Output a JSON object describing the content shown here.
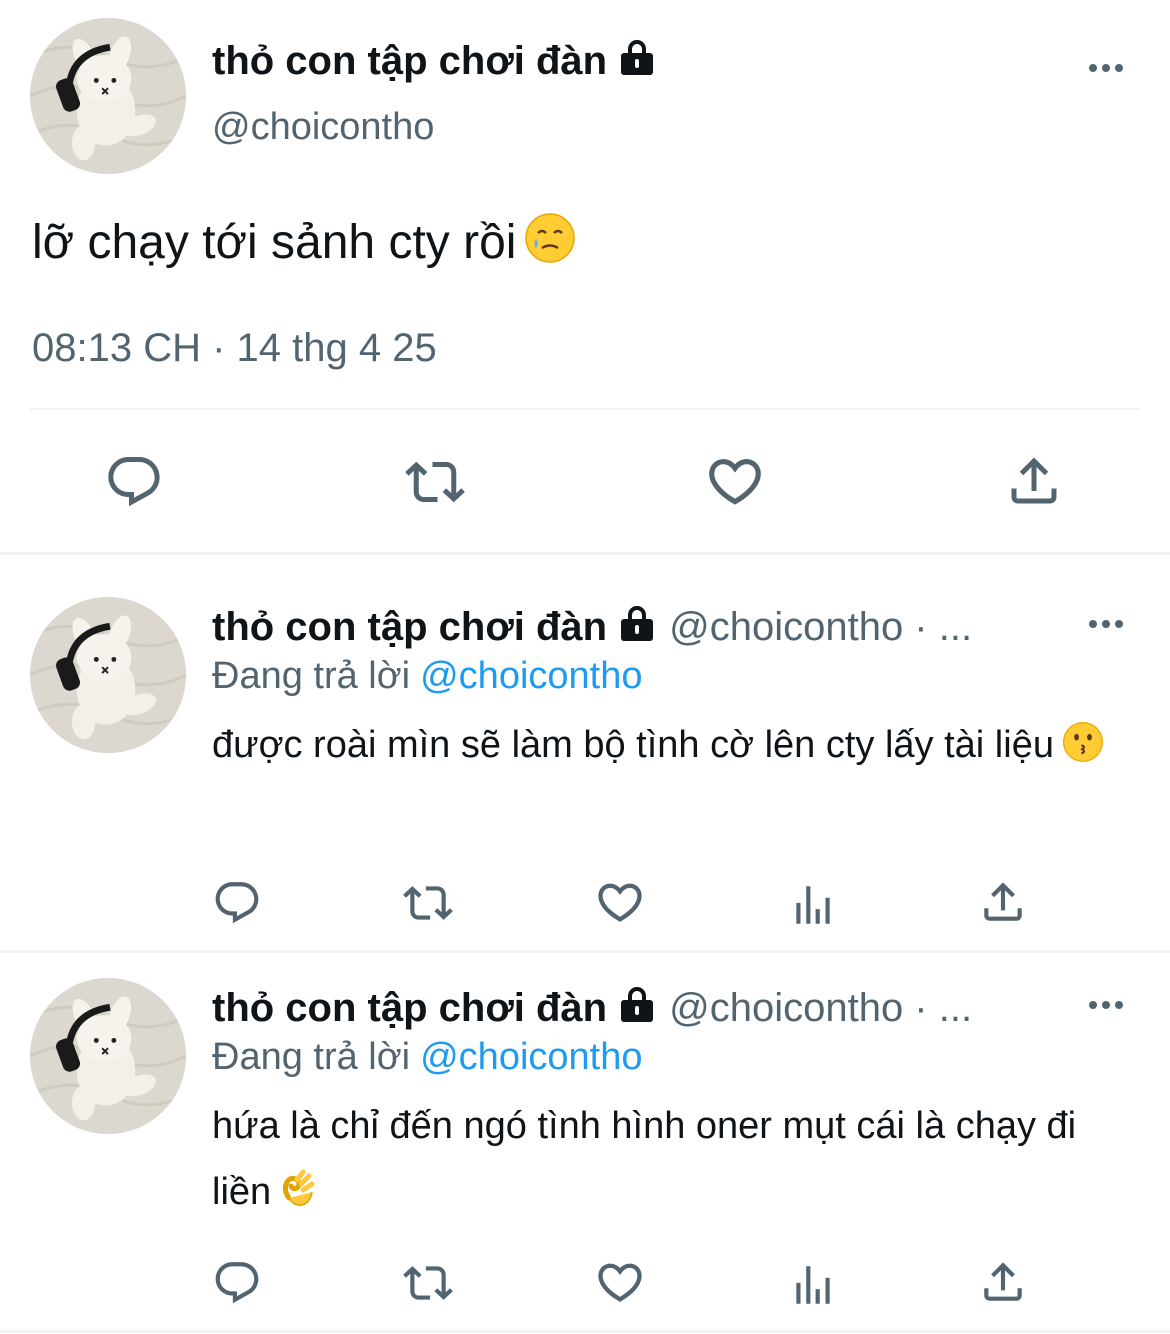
{
  "main_tweet": {
    "author_name": "thỏ con tập chơi đàn",
    "author_handle": "@choicontho",
    "text": "lỡ chạy tới sảnh cty rồi",
    "text_emoji": "face-holding-back-tears",
    "timestamp": "08:13 CH · 14 thg 4 25",
    "actions": [
      "reply-icon",
      "retweet-icon",
      "like-icon",
      "share-icon"
    ]
  },
  "replies": [
    {
      "author_name": "thỏ con tập chơi đàn",
      "author_handle": "@choicontho · ...",
      "replying_label": "Đang trả lời",
      "replying_to": "@choicontho",
      "text": "được roài mìn sẽ làm bộ tình cờ lên cty lấy tài liệu",
      "text_emoji": "kissing-face"
    },
    {
      "author_name": "thỏ con tập chơi đàn",
      "author_handle": "@choicontho · ...",
      "replying_label": "Đang trả lời",
      "replying_to": "@choicontho",
      "text": "hứa là chỉ đến ngó tình hình oner mụt cái là chạy đi liền",
      "text_emoji": "ok-hand"
    }
  ],
  "colors": {
    "text": "#0f1419",
    "secondary": "#536471",
    "link": "#1d9bf0",
    "divider": "#eff3f4"
  }
}
